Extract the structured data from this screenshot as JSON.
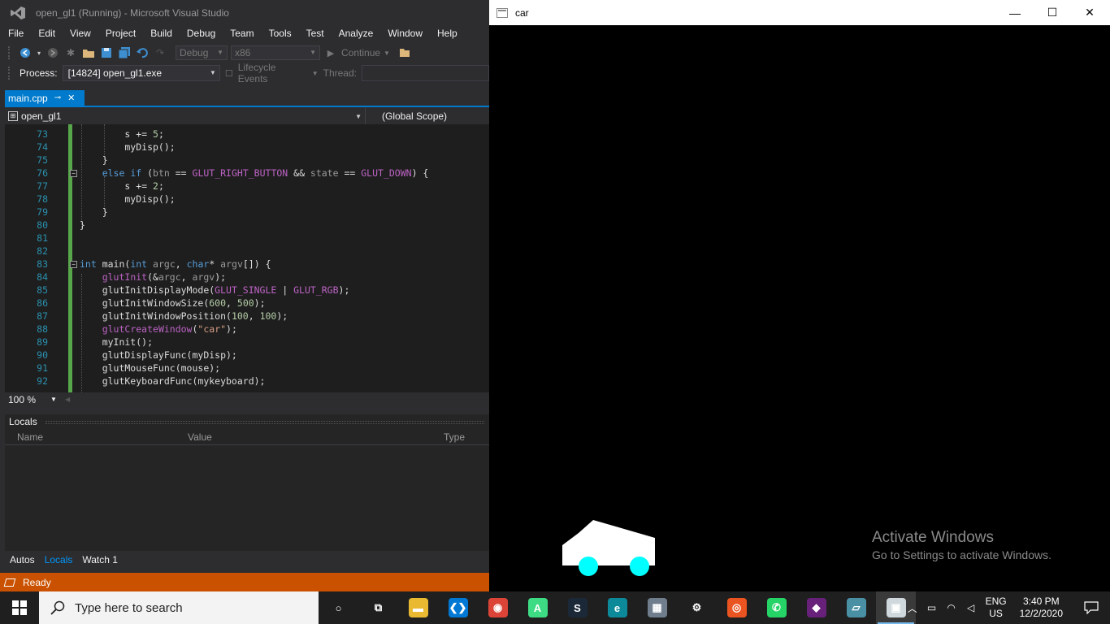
{
  "vs": {
    "title": "open_gl1 (Running) - Microsoft Visual Studio",
    "menu": [
      "File",
      "Edit",
      "View",
      "Project",
      "Build",
      "Debug",
      "Team",
      "Tools",
      "Test",
      "Analyze",
      "Window",
      "Help"
    ],
    "toolbar": {
      "config": "Debug",
      "platform": "x86",
      "continue_label": "Continue"
    },
    "debugbar": {
      "process_label": "Process:",
      "process_value": "[14824] open_gl1.exe",
      "lifecycle_label": "Lifecycle Events",
      "thread_label": "Thread:"
    },
    "tab": {
      "label": "main.cpp",
      "pin": "⊸",
      "close": "✕"
    },
    "nav": {
      "project": "open_gl1",
      "scope": "(Global Scope)"
    },
    "code_lines": [
      {
        "n": "73",
        "html": "        s += <span class=\"num\">5</span>;"
      },
      {
        "n": "74",
        "html": "        myDisp();"
      },
      {
        "n": "75",
        "html": "    }"
      },
      {
        "n": "76",
        "html": "    <span class=\"kw\">else if</span> (<span class=\"prm\">btn</span> == <span class=\"mac\">GLUT_RIGHT_BUTTON</span> &amp;&amp; <span class=\"prm\">state</span> == <span class=\"mac\">GLUT_DOWN</span>) {"
      },
      {
        "n": "77",
        "html": "        s += <span class=\"num\">2</span>;"
      },
      {
        "n": "78",
        "html": "        myDisp();"
      },
      {
        "n": "79",
        "html": "    }"
      },
      {
        "n": "80",
        "html": "}"
      },
      {
        "n": "81",
        "html": ""
      },
      {
        "n": "82",
        "html": ""
      },
      {
        "n": "83",
        "html": "<span class=\"kw\">int</span> main(<span class=\"kw\">int</span> <span class=\"prm\">argc</span>, <span class=\"kw\">char</span>* <span class=\"prm\">argv</span>[]) {"
      },
      {
        "n": "84",
        "html": "    <span class=\"mac\">glutInit</span>(&amp;<span class=\"prm\">argc</span>, <span class=\"prm\">argv</span>);"
      },
      {
        "n": "85",
        "html": "    glutInitDisplayMode(<span class=\"mac\">GLUT_SINGLE</span> | <span class=\"mac\">GLUT_RGB</span>);"
      },
      {
        "n": "86",
        "html": "    glutInitWindowSize(<span class=\"num\">600</span>, <span class=\"num\">500</span>);"
      },
      {
        "n": "87",
        "html": "    glutInitWindowPosition(<span class=\"num\">100</span>, <span class=\"num\">100</span>);"
      },
      {
        "n": "88",
        "html": "    <span class=\"mac\">glutCreateWindow</span>(<span class=\"str\">\"car\"</span>);"
      },
      {
        "n": "89",
        "html": "    myInit();"
      },
      {
        "n": "90",
        "html": "    glutDisplayFunc(myDisp);"
      },
      {
        "n": "91",
        "html": "    glutMouseFunc(mouse);"
      },
      {
        "n": "92",
        "html": "    glutKeyboardFunc(mykeyboard);"
      }
    ],
    "zoom": "100 %",
    "locals": {
      "title": "Locals",
      "columns": [
        "Name",
        "Value",
        "Type"
      ]
    },
    "bottom_tabs": [
      "Autos",
      "Locals",
      "Watch 1"
    ],
    "active_bottom_tab": "Locals",
    "status": "Ready",
    "colors": {
      "accent": "#007acc",
      "status_debug": "#ca5100"
    }
  },
  "glut": {
    "title": "car",
    "minimize": "—",
    "maximize": "☐",
    "close": "✕",
    "car": {
      "body_color": "#ffffff",
      "wheel_color": "#00ffff"
    }
  },
  "watermark": {
    "title": "Activate Windows",
    "subtitle": "Go to Settings to activate Windows."
  },
  "taskbar": {
    "search_placeholder": "Type here to search",
    "apps": [
      {
        "name": "cortana-icon",
        "glyph": "○",
        "color": "transparent"
      },
      {
        "name": "task-view-icon",
        "glyph": "⧉",
        "color": "transparent"
      },
      {
        "name": "file-explorer-icon",
        "glyph": "▬",
        "color": "#e8b931"
      },
      {
        "name": "vscode-icon",
        "glyph": "❮❯",
        "color": "#0078d4"
      },
      {
        "name": "chrome-icon",
        "glyph": "◉",
        "color": "#db4437"
      },
      {
        "name": "android-studio-icon",
        "glyph": "A",
        "color": "#3ddc84"
      },
      {
        "name": "steam-icon",
        "glyph": "S",
        "color": "#1b2838"
      },
      {
        "name": "edge-icon",
        "glyph": "e",
        "color": "#0c8a9a"
      },
      {
        "name": "photos-icon",
        "glyph": "▦",
        "color": "#6f7d8c"
      },
      {
        "name": "settings-icon",
        "glyph": "⚙",
        "color": "transparent"
      },
      {
        "name": "ubuntu-icon",
        "glyph": "◎",
        "color": "#e95420"
      },
      {
        "name": "whatsapp-icon",
        "glyph": "✆",
        "color": "#25d366"
      },
      {
        "name": "visual-studio-icon",
        "glyph": "◆",
        "color": "#68217a"
      },
      {
        "name": "notepad-icon",
        "glyph": "▱",
        "color": "#4a90a4"
      },
      {
        "name": "glut-app-icon",
        "glyph": "▣",
        "color": "#cfd8dc"
      }
    ],
    "active_app": "glut-app-icon",
    "lang_top": "ENG",
    "lang_bottom": "US",
    "time": "3:40 PM",
    "date": "12/2/2020"
  }
}
